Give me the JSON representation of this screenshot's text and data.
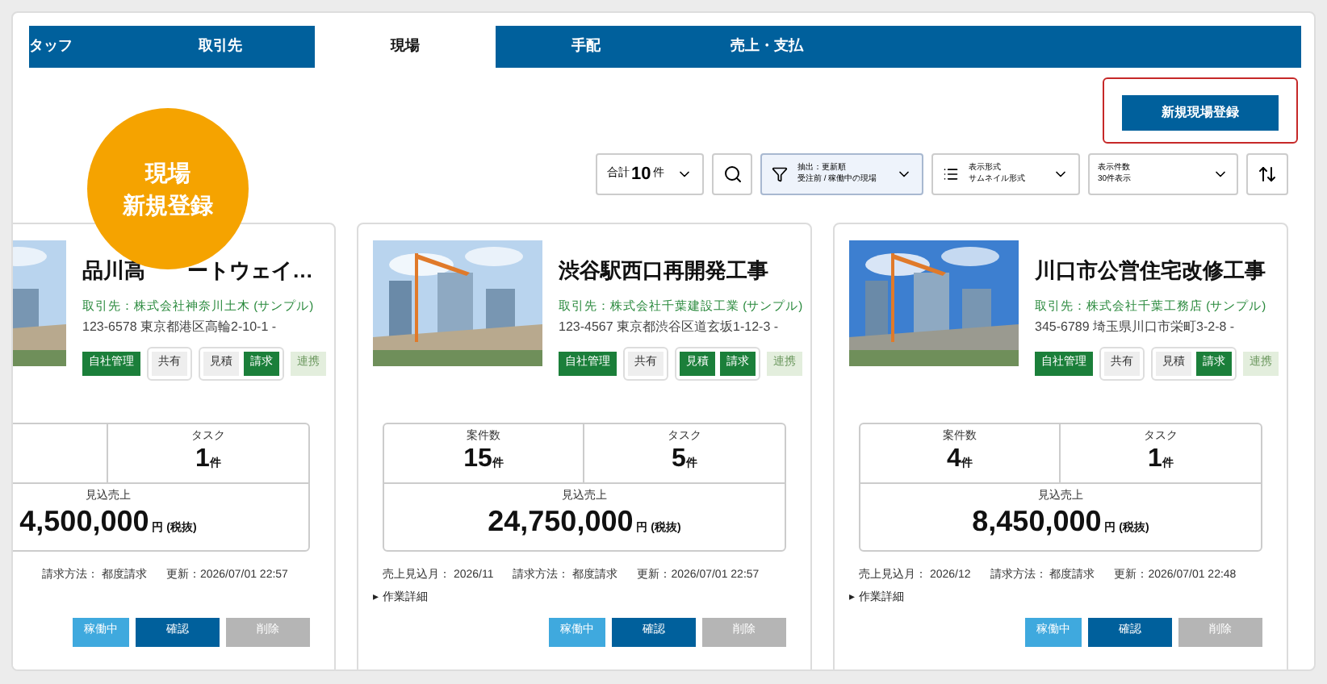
{
  "tabs": [
    {
      "label": "タッフ",
      "selected": false
    },
    {
      "label": "取引先",
      "selected": false
    },
    {
      "label": "現場",
      "selected": true
    },
    {
      "label": "手配",
      "selected": false
    },
    {
      "label": "売上・支払",
      "selected": false
    }
  ],
  "new_site_button": "新規現場登録",
  "badge": {
    "line1": "現場",
    "line2": "新規登録"
  },
  "toolbar": {
    "total_prefix": "合計",
    "total_count": "10",
    "total_suffix": "件",
    "filter": {
      "line1": "抽出：更新順",
      "line2": "受注前 / 稼働中の現場"
    },
    "view": {
      "line1": "表示形式",
      "line2": "サムネイル形式"
    },
    "per_page": {
      "line1": "表示件数",
      "line2": "30件表示"
    }
  },
  "cards": [
    {
      "title_parts": [
        "品川高",
        "ートウェイ…"
      ],
      "client": "取引先：株式会社神奈川土木 (サンプル)",
      "address": "123-6578 東京都港区高輪2-10-1 -",
      "tags": [
        {
          "label": "自社管理",
          "kind": "solid",
          "active": true
        },
        {
          "label": "共有",
          "kind": "boxed",
          "active": false
        }
      ],
      "tag_group": [
        {
          "label": "見積",
          "active": false
        },
        {
          "label": "請求",
          "active": true
        }
      ],
      "extra_tag": "連携",
      "stats": {
        "task_label": "タスク",
        "task_value": "1",
        "task_unit": "件",
        "sales_label": "見込売上",
        "sales_value": "4,500,000",
        "sales_unit": "円 (税抜)"
      },
      "footer": [
        "請求方法： 都度請求",
        "更新：2026/07/01 22:57"
      ],
      "buttons": [
        "稼働中",
        "確認",
        "削除"
      ]
    },
    {
      "title": "渋谷駅西口再開発工事",
      "client": "取引先：株式会社千葉建設工業 (サンプル)",
      "address": "123-4567 東京都渋谷区道玄坂1-12-3 -",
      "tags": [
        {
          "label": "自社管理",
          "kind": "solid",
          "active": true
        },
        {
          "label": "共有",
          "kind": "boxed",
          "active": false
        }
      ],
      "tag_group": [
        {
          "label": "見積",
          "active": true
        },
        {
          "label": "請求",
          "active": true
        }
      ],
      "extra_tag": "連携",
      "stats": {
        "cases_label": "案件数",
        "cases_value": "15",
        "cases_unit": "件",
        "task_label": "タスク",
        "task_value": "5",
        "task_unit": "件",
        "sales_label": "見込売上",
        "sales_value": "24,750,000",
        "sales_unit": "円 (税抜)"
      },
      "footer": [
        "売上見込月： 2026/11",
        "請求方法： 都度請求",
        "更新：2026/07/01 22:57"
      ],
      "details_marker": "▸",
      "details": "作業詳細",
      "buttons": [
        "稼働中",
        "確認",
        "削除"
      ]
    },
    {
      "title": "川口市公営住宅改修工事",
      "client": "取引先：株式会社千葉工務店 (サンプル)",
      "address": "345-6789 埼玉県川口市栄町3-2-8 -",
      "tags": [
        {
          "label": "自社管理",
          "kind": "solid",
          "active": true
        },
        {
          "label": "共有",
          "kind": "boxed",
          "active": false
        }
      ],
      "tag_group": [
        {
          "label": "見積",
          "active": false
        },
        {
          "label": "請求",
          "active": true
        }
      ],
      "extra_tag": "連携",
      "stats": {
        "cases_label": "案件数",
        "cases_value": "4",
        "cases_unit": "件",
        "task_label": "タスク",
        "task_value": "1",
        "task_unit": "件",
        "sales_label": "見込売上",
        "sales_value": "8,450,000",
        "sales_unit": "円 (税抜)"
      },
      "footer": [
        "売上見込月： 2026/12",
        "請求方法： 都度請求",
        "更新：2026/07/01 22:48"
      ],
      "details_marker": "▸",
      "details": "作業詳細",
      "buttons": [
        "稼働中",
        "確認",
        "削除"
      ]
    }
  ]
}
